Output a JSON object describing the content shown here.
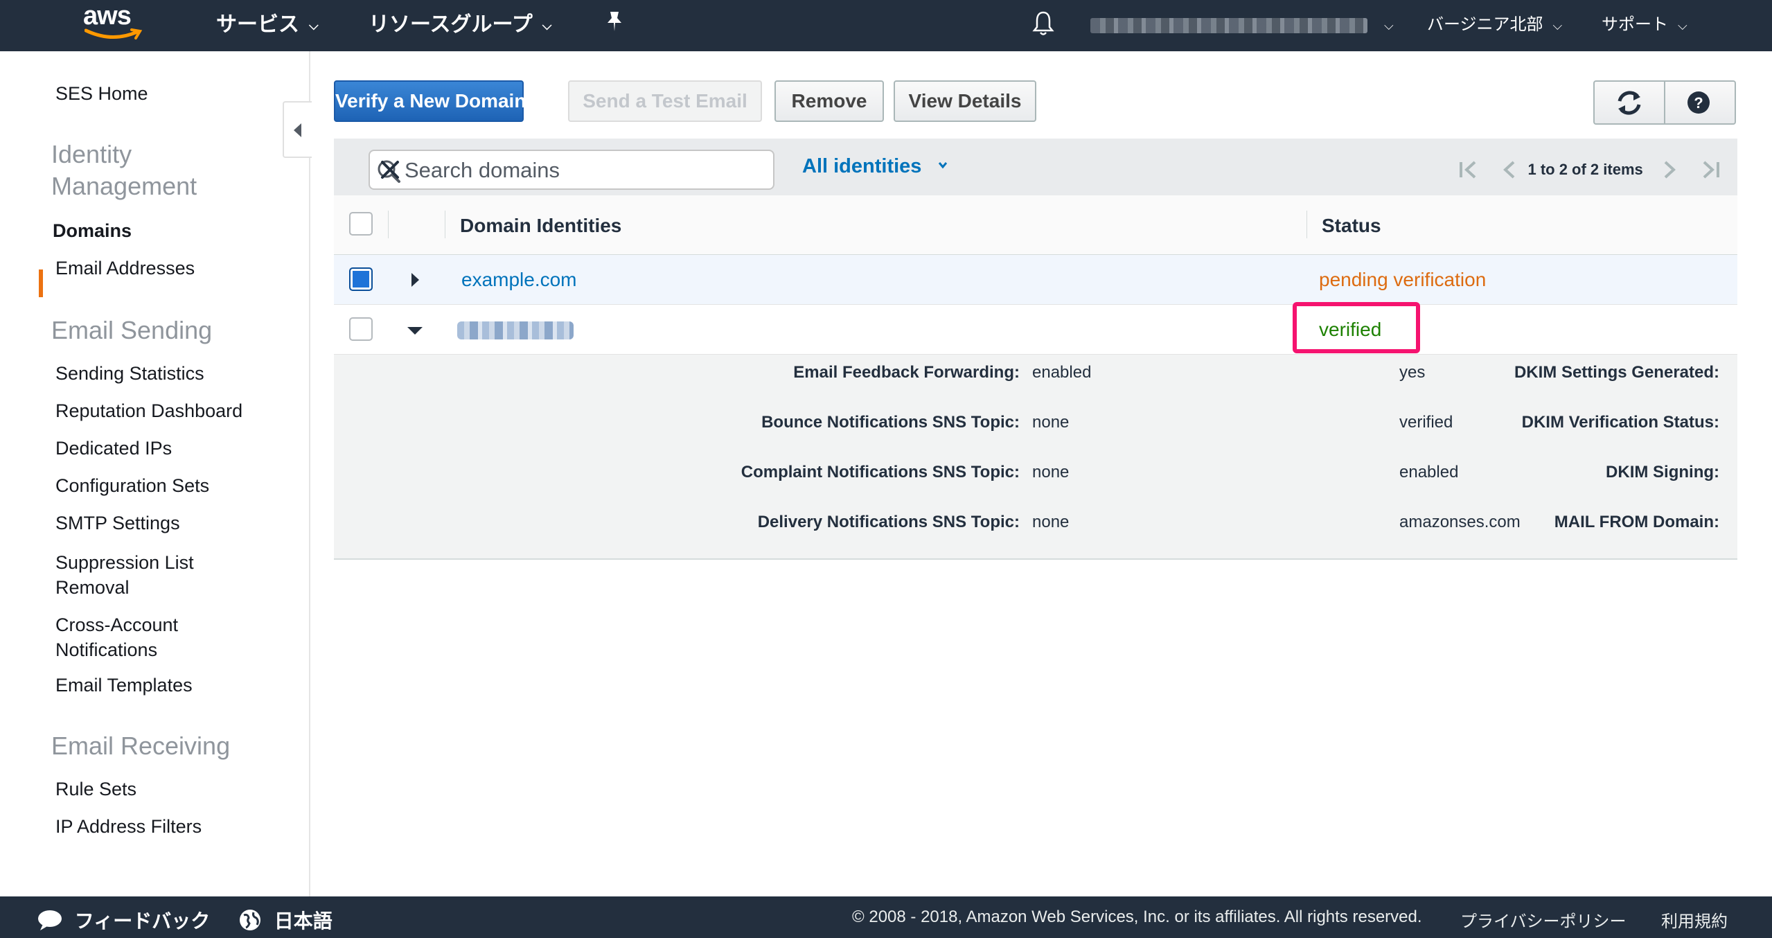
{
  "topnav": {
    "logo_text": "aws",
    "services_label": "サービス",
    "resource_groups_label": "リソースグループ",
    "region_label": "バージニア北部",
    "support_label": "サポート"
  },
  "sidebar": {
    "home": "SES Home",
    "sections": [
      {
        "title": "Identity Management",
        "items": [
          "Domains",
          "Email Addresses"
        ]
      },
      {
        "title": "Email Sending",
        "items": [
          "Sending Statistics",
          "Reputation Dashboard",
          "Dedicated IPs",
          "Configuration Sets",
          "SMTP Settings",
          "Suppression List Removal",
          "Cross-Account Notifications",
          "Email Templates"
        ]
      },
      {
        "title": "Email Receiving",
        "items": [
          "Rule Sets",
          "IP Address Filters"
        ]
      }
    ],
    "active_item": "Domains"
  },
  "toolbar": {
    "verify_label": "Verify a New Domain",
    "test_email_label": "Send a Test Email",
    "remove_label": "Remove",
    "details_label": "View Details"
  },
  "filter": {
    "search_placeholder": "Search domains",
    "dropdown_label": "All identities",
    "pagination": "1 to 2 of 2 items"
  },
  "table": {
    "columns": [
      "Domain Identities",
      "Status"
    ],
    "rows": [
      {
        "domain": "example.com",
        "status": "pending verification",
        "selected": true,
        "expanded": false
      },
      {
        "domain": "",
        "status": "verified",
        "selected": false,
        "expanded": true
      }
    ]
  },
  "details": {
    "left": [
      {
        "key": "Email Feedback Forwarding:",
        "value": "enabled"
      },
      {
        "key": "Bounce Notifications SNS Topic:",
        "value": "none"
      },
      {
        "key": "Complaint Notifications SNS Topic:",
        "value": "none"
      },
      {
        "key": "Delivery Notifications SNS Topic:",
        "value": "none"
      }
    ],
    "right": [
      {
        "key": "DKIM Settings Generated:",
        "value": "yes"
      },
      {
        "key": "DKIM Verification Status:",
        "value": "verified"
      },
      {
        "key": "DKIM Signing:",
        "value": "enabled"
      },
      {
        "key": "MAIL FROM Domain:",
        "value": "amazonses.com"
      }
    ]
  },
  "footer": {
    "feedback_label": "フィードバック",
    "language_label": "日本語",
    "copyright": "© 2008 - 2018, Amazon Web Services, Inc. or its affiliates. All rights reserved.",
    "privacy_label": "プライバシーポリシー",
    "terms_label": "利用規約"
  },
  "colors": {
    "nav_bg": "#232f3e",
    "primary_button": "#1e63b5",
    "link": "#0073bb",
    "pending": "#dd6b10",
    "verified": "#1d8102",
    "active_marker": "#ec7211",
    "highlight_box": "#f5136f"
  },
  "icons": [
    "aws-smile-icon",
    "chevron-down-icon",
    "pin-icon",
    "bell-icon",
    "refresh-icon",
    "help-icon",
    "search-icon",
    "close-icon",
    "first-page-icon",
    "prev-page-icon",
    "next-page-icon",
    "last-page-icon",
    "expand-icon",
    "collapse-icon",
    "chat-icon",
    "globe-icon"
  ]
}
